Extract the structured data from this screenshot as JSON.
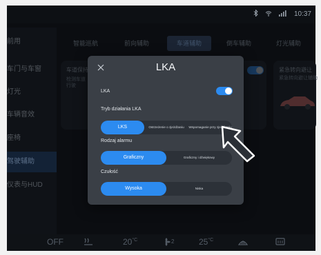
{
  "status": {
    "time": "10:37"
  },
  "sidebar": {
    "items": [
      {
        "label": "前用"
      },
      {
        "label": "车门与车窗"
      },
      {
        "label": "灯光"
      },
      {
        "label": "车辆音效"
      },
      {
        "label": "座椅"
      },
      {
        "label": "驾驶辅助"
      },
      {
        "label": "仪表与HUD"
      },
      {
        "label": ""
      }
    ]
  },
  "tabs": [
    {
      "label": "智能巡航"
    },
    {
      "label": "前向辅助"
    },
    {
      "label": "车道辅助"
    },
    {
      "label": "倒车辅助"
    },
    {
      "label": "灯光辅助"
    }
  ],
  "background_cards": {
    "left_title": "车道保持",
    "left_line1": "检测车道",
    "left_line2": "行驶",
    "right_title": "紧急转向避让",
    "right_line1": "紧急转向避让辅助"
  },
  "bottom_bar": {
    "off_label": "OFF",
    "temp_left": "20",
    "temp_unit": "°C",
    "fan_level": "2",
    "temp_right": "25"
  },
  "dialog": {
    "title": "LKA",
    "close_icon": "close-icon",
    "lka_label": "LKA",
    "lka_enabled": true,
    "mode_label": "Tryb działania LKA",
    "mode_options": [
      {
        "label": "LKS",
        "selected": true
      },
      {
        "label": "Ostrzeżenie o zjeżdżaniu",
        "selected": false
      },
      {
        "label": "Wspomaganie przy zjeżdżaniu",
        "selected": false
      }
    ],
    "alarm_label": "Rodzaj alarmu",
    "alarm_options": [
      {
        "label": "Graficzny",
        "selected": true
      },
      {
        "label": "Graficzny i dźwiękowy",
        "selected": false
      }
    ],
    "sensitivity_label": "Czułość",
    "sensitivity_options": [
      {
        "label": "Wysoka",
        "selected": true
      },
      {
        "label": "Niska",
        "selected": false
      }
    ]
  },
  "colors": {
    "accent": "#2c8bf0",
    "dialog_bg": "#3a3f46",
    "screen_bg": "#0d1014"
  }
}
